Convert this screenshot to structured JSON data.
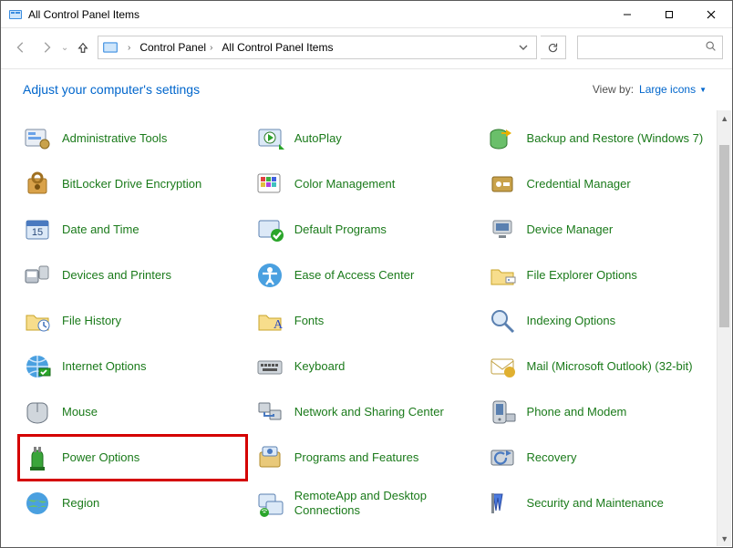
{
  "window": {
    "title": "All Control Panel Items"
  },
  "breadcrumb": {
    "parts": [
      "Control Panel",
      "All Control Panel Items"
    ]
  },
  "header": {
    "heading": "Adjust your computer's settings",
    "viewby_label": "View by:",
    "viewby_value": "Large icons"
  },
  "items": [
    {
      "label": "Administrative Tools",
      "icon": "tools",
      "highlight": false
    },
    {
      "label": "AutoPlay",
      "icon": "autoplay",
      "highlight": false
    },
    {
      "label": "Backup and Restore (Windows 7)",
      "icon": "backup",
      "highlight": false
    },
    {
      "label": "BitLocker Drive Encryption",
      "icon": "bitlocker",
      "highlight": false
    },
    {
      "label": "Color Management",
      "icon": "color",
      "highlight": false
    },
    {
      "label": "Credential Manager",
      "icon": "credential",
      "highlight": false
    },
    {
      "label": "Date and Time",
      "icon": "datetime",
      "highlight": false
    },
    {
      "label": "Default Programs",
      "icon": "defaults",
      "highlight": false
    },
    {
      "label": "Device Manager",
      "icon": "devmgr",
      "highlight": false
    },
    {
      "label": "Devices and Printers",
      "icon": "devices",
      "highlight": false
    },
    {
      "label": "Ease of Access Center",
      "icon": "ease",
      "highlight": false
    },
    {
      "label": "File Explorer Options",
      "icon": "folderopt",
      "highlight": false
    },
    {
      "label": "File History",
      "icon": "filehist",
      "highlight": false
    },
    {
      "label": "Fonts",
      "icon": "fonts",
      "highlight": false
    },
    {
      "label": "Indexing Options",
      "icon": "indexing",
      "highlight": false
    },
    {
      "label": "Internet Options",
      "icon": "internet",
      "highlight": false
    },
    {
      "label": "Keyboard",
      "icon": "keyboard",
      "highlight": false
    },
    {
      "label": "Mail (Microsoft Outlook) (32-bit)",
      "icon": "mail",
      "highlight": false
    },
    {
      "label": "Mouse",
      "icon": "mouse",
      "highlight": false
    },
    {
      "label": "Network and Sharing Center",
      "icon": "network",
      "highlight": false
    },
    {
      "label": "Phone and Modem",
      "icon": "phone",
      "highlight": false
    },
    {
      "label": "Power Options",
      "icon": "power",
      "highlight": true
    },
    {
      "label": "Programs and Features",
      "icon": "programs",
      "highlight": false
    },
    {
      "label": "Recovery",
      "icon": "recovery",
      "highlight": false
    },
    {
      "label": "Region",
      "icon": "region",
      "highlight": false
    },
    {
      "label": "RemoteApp and Desktop Connections",
      "icon": "remote",
      "highlight": false
    },
    {
      "label": "Security and Maintenance",
      "icon": "security",
      "highlight": false
    }
  ]
}
